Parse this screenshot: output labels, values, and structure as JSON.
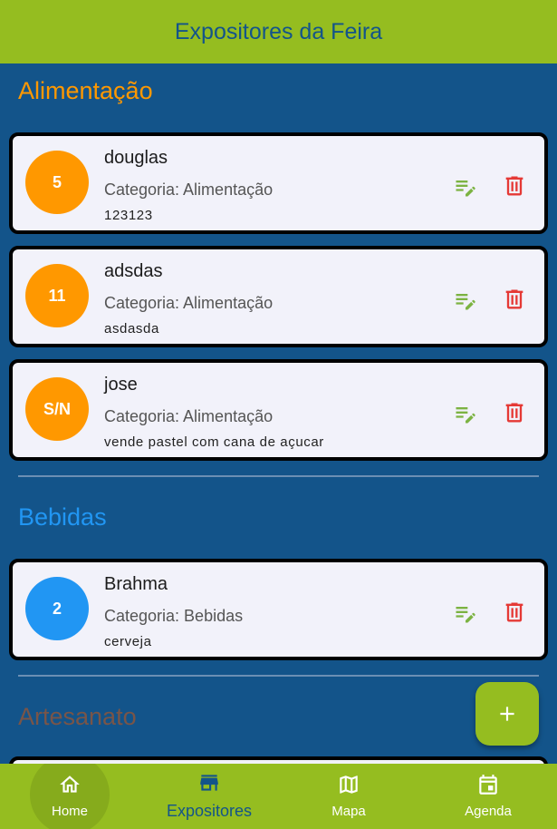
{
  "appbar": {
    "title": "Expositores da Feira"
  },
  "sections": [
    {
      "title": "Alimentação",
      "color": "#ff9800"
    },
    {
      "title": "Bebidas",
      "color": "#2196f3"
    },
    {
      "title": "Artesanato",
      "color": "#795548"
    }
  ],
  "cards": [
    {
      "badge": "5",
      "name": "douglas",
      "category": "Categoria: Alimentação",
      "description": "123123",
      "avatar_color": "#ff9800"
    },
    {
      "badge": "11",
      "name": "adsdas",
      "category": "Categoria: Alimentação",
      "description": "asdasda",
      "avatar_color": "#ff9800"
    },
    {
      "badge": "S/N",
      "name": "jose",
      "category": "Categoria: Alimentação",
      "description": "vende pastel com cana de açucar",
      "avatar_color": "#ff9800"
    },
    {
      "badge": "2",
      "name": "Brahma",
      "category": "Categoria: Bebidas",
      "description": "cerveja",
      "avatar_color": "#2196f3"
    }
  ],
  "icons": {
    "edit": "edit-note-icon",
    "delete": "delete-icon",
    "fab": "add-icon"
  },
  "colors": {
    "primary": "#95bd20",
    "background": "#13548a",
    "edit": "#7cb342",
    "delete": "#e53935"
  },
  "nav": {
    "home": {
      "label": "Home",
      "icon": "home-icon"
    },
    "expositores": {
      "label": "Expositores",
      "icon": "store-icon"
    },
    "mapa": {
      "label": "Mapa",
      "icon": "map-icon"
    },
    "agenda": {
      "label": "Agenda",
      "icon": "calendar-icon"
    },
    "selected": "Expositores"
  }
}
